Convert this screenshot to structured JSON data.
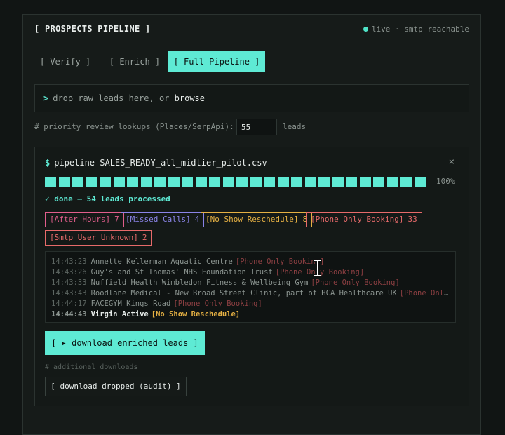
{
  "header": {
    "title": "[ PROSPECTS PIPELINE ]",
    "status": "live · smtp reachable"
  },
  "tabs": [
    {
      "label": "[ Verify ]",
      "active": false
    },
    {
      "label": "[ Enrich ]",
      "active": false
    },
    {
      "label": "[ Full Pipeline ]",
      "active": true
    }
  ],
  "dropzone": {
    "prompt": ">",
    "text": "drop raw leads here, or",
    "link": "browse"
  },
  "priority": {
    "label": "# priority review lookups (Places/SerpApi):",
    "value": "55",
    "unit": "leads"
  },
  "job": {
    "title_prefix": "$",
    "title": "pipeline SALES_READY_all_midtier_pilot.csv",
    "close": "×",
    "progress": 1.0,
    "progress_label": "100%",
    "done_text": "✓ done — 54 leads processed",
    "tags": [
      {
        "label": "[After Hours]",
        "count": "7",
        "color": "#e15e8c"
      },
      {
        "label": "[Missed Calls]",
        "count": "4",
        "color": "#8b84e8"
      },
      {
        "label": "[No Show Reschedule]",
        "count": "8",
        "color": "#e5b043"
      },
      {
        "label": "[Phone Only Booking]",
        "count": "33",
        "color": "#e76a6a"
      },
      {
        "label": "[Smtp User Unknown]",
        "count": "2",
        "color": "#e76a6a"
      }
    ],
    "log": [
      {
        "time": "14:43:23",
        "name": "Annette Kellerman Aquatic Centre",
        "tag": "[Phone Only Booking]",
        "tag_color": "#8c3f42"
      },
      {
        "time": "14:43:26",
        "name": "Guy's and St Thomas' NHS Foundation Trust",
        "tag": "[Phone Only Booking]",
        "tag_color": "#8c3f42"
      },
      {
        "time": "14:43:33",
        "name": "Nuffield Health Wimbledon Fitness & Wellbeing Gym",
        "tag": "[Phone Only Booking]",
        "tag_color": "#8c3f42"
      },
      {
        "time": "14:43:43",
        "name": "Roodlane Medical - New Broad Street Clinic, part of HCA Healthcare UK",
        "tag": "[Phone Only Booking]",
        "tag_color": "#8c3f42"
      },
      {
        "time": "14:44:17",
        "name": "FACEGYM Kings Road",
        "tag": "[Phone Only Booking]",
        "tag_color": "#8c3f42"
      },
      {
        "time": "14:44:43",
        "name": "Virgin Active",
        "tag": "[No Show Reschedule]",
        "tag_color": "#e5b043"
      }
    ],
    "download_button": "[ ▸ download enriched leads ]",
    "additional_label": "# additional downloads",
    "audit_button": "[ download dropped (audit) ]"
  }
}
